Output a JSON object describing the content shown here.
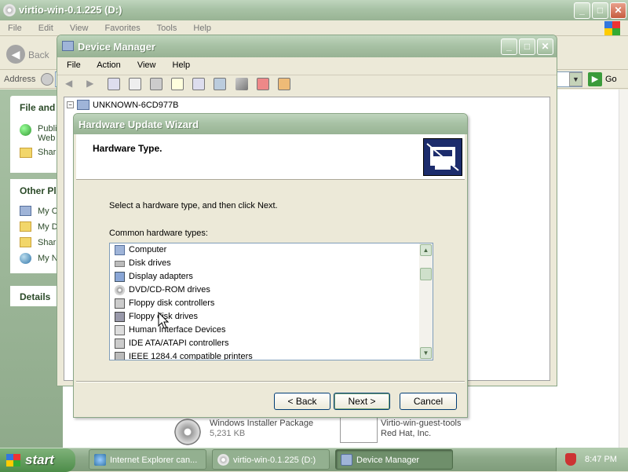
{
  "explorer": {
    "title": "virtio-win-0.1.225 (D:)",
    "menu": [
      "File",
      "Edit",
      "View",
      "Favorites",
      "Tools",
      "Help"
    ],
    "back_label": "Back",
    "address_label": "Address",
    "go_label": "Go",
    "panel_file_header": "File and",
    "panel_file_items": [
      "Publi",
      "Web",
      "Shar"
    ],
    "panel_other_header": "Other Pl",
    "panel_other_items": [
      "My C",
      "My D",
      "Shar",
      "My N"
    ],
    "panel_details_header": "Details",
    "files": [
      {
        "name": "Windows Installer Package",
        "detail": "5,231 KB"
      },
      {
        "name": "Virtio-win-guest-tools",
        "detail": "Red Hat, Inc."
      }
    ]
  },
  "device_manager": {
    "title": "Device Manager",
    "menu": [
      "File",
      "Action",
      "View",
      "Help"
    ],
    "tree_root": "UNKNOWN-6CD977B"
  },
  "wizard": {
    "title": "Hardware Update Wizard",
    "header": "Hardware Type.",
    "instruction": "Select a hardware type, and then click Next.",
    "list_label": "Common hardware types:",
    "items": [
      "Computer",
      "Disk drives",
      "Display adapters",
      "DVD/CD-ROM drives",
      "Floppy disk controllers",
      "Floppy disk drives",
      "Human Interface Devices",
      "IDE ATA/ATAPI controllers",
      "IEEE 1284.4 compatible printers"
    ],
    "back_label": "< Back",
    "next_label": "Next >",
    "cancel_label": "Cancel"
  },
  "taskbar": {
    "start_label": "start",
    "tasks": [
      "Internet Explorer can...",
      "virtio-win-0.1.225 (D:)",
      "Device Manager"
    ],
    "clock": "8:47 PM"
  }
}
